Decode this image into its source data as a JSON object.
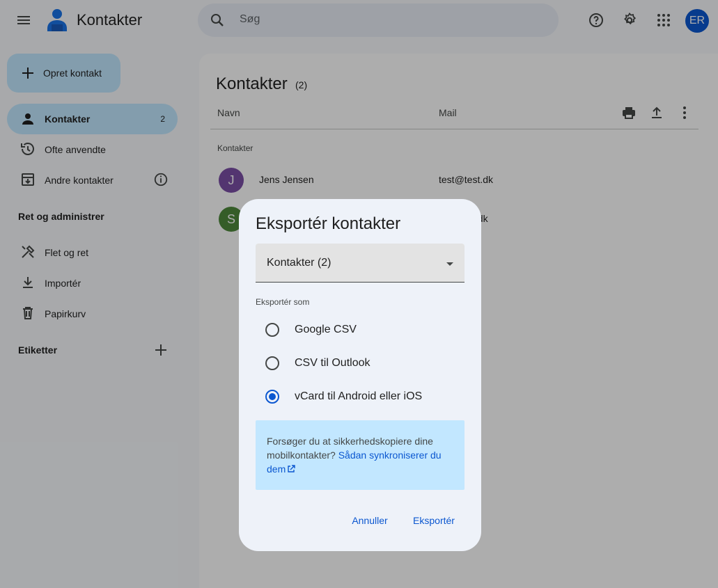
{
  "app": {
    "title": "Kontakter",
    "avatar_initials": "ER"
  },
  "search": {
    "placeholder": "Søg"
  },
  "topbar_icons": [
    "menu-icon",
    "help-icon",
    "settings-icon",
    "apps-icon"
  ],
  "sidebar": {
    "create_label": "Opret kontakt",
    "items": [
      {
        "label": "Kontakter",
        "count": "2",
        "icon": "person-icon",
        "active": true
      },
      {
        "label": "Ofte anvendte",
        "icon": "history-icon"
      },
      {
        "label": "Andre kontakter",
        "icon": "archive-icon"
      }
    ],
    "manage_title": "Ret og administrer",
    "manage_items": [
      {
        "label": "Flet og ret",
        "icon": "tools-icon"
      },
      {
        "label": "Importér",
        "icon": "download-icon"
      },
      {
        "label": "Papirkurv",
        "icon": "trash-icon"
      }
    ],
    "labels_title": "Etiketter"
  },
  "main": {
    "title": "Kontakter",
    "count": "(2)",
    "columns": [
      "Navn",
      "Mail"
    ],
    "group_label": "Kontakter",
    "rows": [
      {
        "initial": "J",
        "name": "Jens Jensen",
        "email": "test@test.dk",
        "color": "#7b4fa6"
      },
      {
        "initial": "S",
        "name": "",
        "email": "t.dk",
        "color": "#4f8a3c"
      }
    ]
  },
  "dialog": {
    "title": "Eksportér kontakter",
    "select_value": "Kontakter (2)",
    "export_as_label": "Eksportér som",
    "options": [
      {
        "label": "Google CSV",
        "selected": false
      },
      {
        "label": "CSV til Outlook",
        "selected": false
      },
      {
        "label": "vCard til Android eller iOS",
        "selected": true
      }
    ],
    "info_text": "Forsøger du at sikkerhedskopiere dine mobilkontakter? ",
    "info_link": "Sådan synkroniserer du dem",
    "cancel_label": "Annuller",
    "export_label": "Eksportér"
  },
  "colors": {
    "accent": "#0b57d0",
    "selected_bg": "#c2e7ff"
  }
}
